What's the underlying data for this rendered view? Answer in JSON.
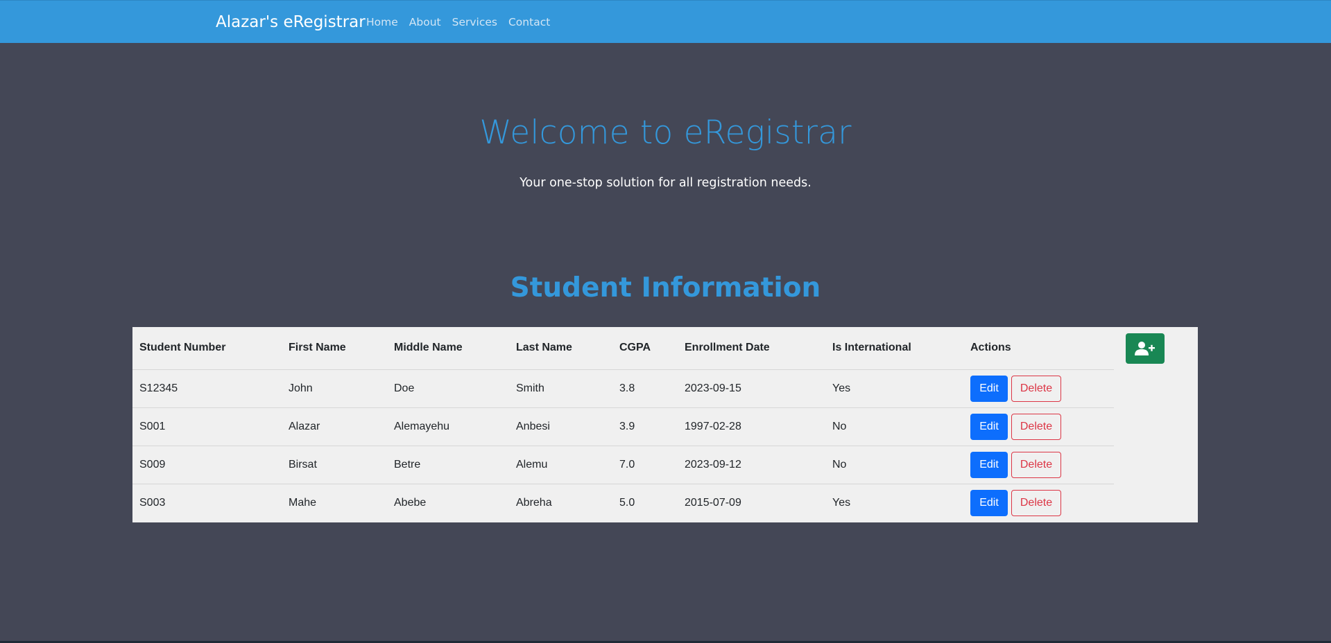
{
  "navbar": {
    "brand": "Alazar's eRegistrar",
    "links": [
      "Home",
      "About",
      "Services",
      "Contact"
    ],
    "color": "#3498db"
  },
  "hero": {
    "title": "Welcome to eRegistrar",
    "subtitle": "Your one-stop solution for all registration needs."
  },
  "section": {
    "title": "Student Information"
  },
  "table": {
    "headers": [
      "Student Number",
      "First Name",
      "Middle Name",
      "Last Name",
      "CGPA",
      "Enrollment Date",
      "Is International",
      "Actions"
    ],
    "rows": [
      [
        "S12345",
        "John",
        "Doe",
        "Smith",
        "3.8",
        "2023-09-15",
        "Yes"
      ],
      [
        "S001",
        "Alazar",
        "Alemayehu",
        "Anbesi",
        "3.9",
        "1997-02-28",
        "No"
      ],
      [
        "S009",
        "Birsat",
        "Betre",
        "Alemu",
        "7.0",
        "2023-09-12",
        "No"
      ],
      [
        "S003",
        "Mahe",
        "Abebe",
        "Abreha",
        "5.0",
        "2015-07-09",
        "Yes"
      ]
    ],
    "edit_label": "Edit",
    "delete_label": "Delete",
    "add_icon": "add-user-icon"
  },
  "colors": {
    "page_bg": "#444756",
    "accent": "#3498db",
    "edit": "#0d6efd",
    "delete": "#dc3545",
    "add": "#198754"
  }
}
